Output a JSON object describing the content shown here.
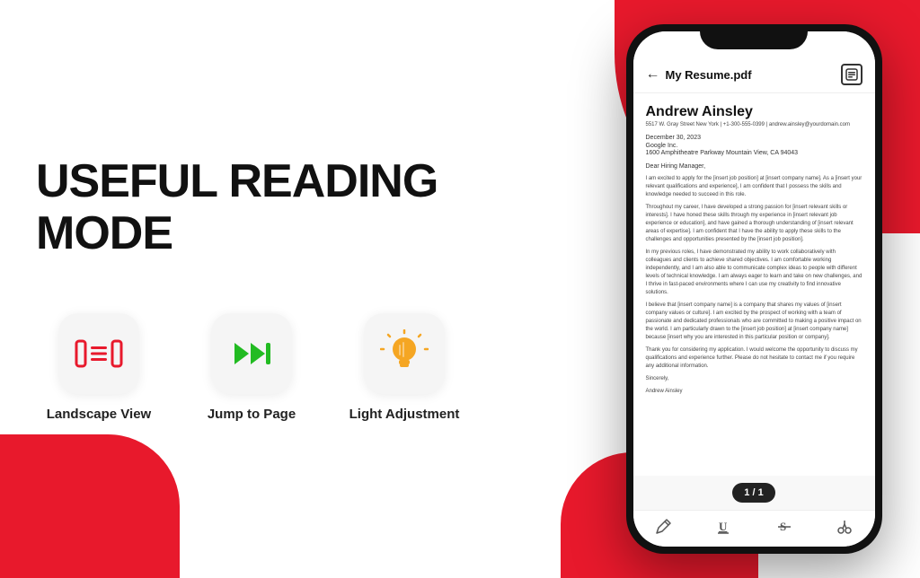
{
  "app": {
    "title": "USEFUL READING MODE"
  },
  "background": {
    "accent_color": "#e8192c"
  },
  "features": [
    {
      "id": "landscape",
      "label": "Landscape View",
      "icon_type": "landscape"
    },
    {
      "id": "jump",
      "label": "Jump to Page",
      "icon_type": "jump"
    },
    {
      "id": "light",
      "label": "Light Adjustment",
      "icon_type": "light"
    }
  ],
  "phone": {
    "header": {
      "title": "My Resume.pdf",
      "back_label": "←"
    },
    "pdf": {
      "name": "Andrew Ainsley",
      "contact": "5517 W. Gray Street  New York | +1-300-555-0399 | andrew.ainsley@yourdomain.com",
      "date": "December 30, 2023",
      "company_name": "Google Inc.",
      "company_address": "1600 Amphitheatre Parkway Mountain View, CA 94043",
      "greeting": "Dear Hiring Manager,",
      "paragraphs": [
        "I am excited to apply for the [insert job position] at [insert company name]. As a [insert your relevant qualifications and experience], I am confident that I possess the skills and knowledge needed to succeed in this role.",
        "Throughout my career, I have developed a strong passion for [insert relevant skills or interests]. I have honed these skills through my experience in [insert relevant job experience or education], and have gained a thorough understanding of [insert relevant areas of expertise]. I am confident that I have the ability to apply these skills to the challenges and opportunities presented by the [insert job position].",
        "In my previous roles, I have demonstrated my ability to work collaboratively with colleagues and clients to achieve shared objectives. I am comfortable working independently, and I am also able to communicate complex ideas to people with different levels of technical knowledge. I am always eager to learn and take on new challenges, and I thrive in fast-paced environments where I can use my creativity to find innovative solutions.",
        "I believe that [insert company name] is a company that shares my values of [insert company values or culture]. I am excited by the prospect of working with a team of passionate and dedicated professionals who are committed to making a positive impact on the world. I am particularly drawn to the [insert job position] at [insert company name] because [insert why you are interested in this particular position or company].",
        "Thank you for considering my application. I would welcome the opportunity to discuss my qualifications and experience further. Please do not hesitate to contact me if you require any additional information.",
        "Sincerely,",
        "Andrew Ainsley"
      ]
    },
    "page_indicator": "1 / 1",
    "toolbar": {
      "pen_icon": "✏️",
      "underline_icon": "U",
      "strikethrough_icon": "S",
      "more_icon": "✂️"
    }
  }
}
